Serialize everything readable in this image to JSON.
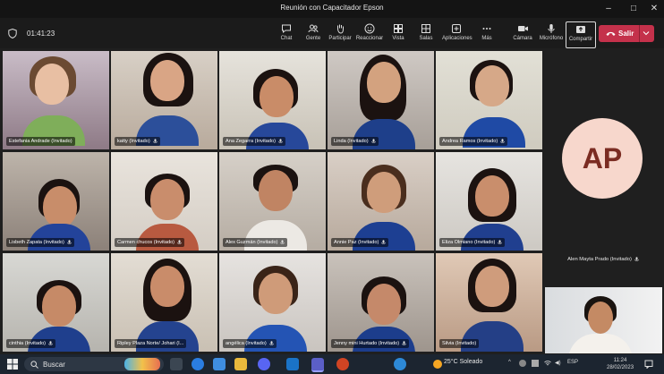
{
  "window": {
    "title": "Reunión con Capacitador Epson",
    "minimize": "–",
    "maximize": "□",
    "close": "✕"
  },
  "toolbar": {
    "timer": "01:41:23",
    "buttons": [
      {
        "label": "Chat",
        "icon": "chat-icon"
      },
      {
        "label": "Gente",
        "icon": "people-icon"
      },
      {
        "label": "Participar",
        "icon": "raise-hand-icon"
      },
      {
        "label": "Reaccionar",
        "icon": "emoji-icon"
      },
      {
        "label": "Vista",
        "icon": "grid-view-icon"
      },
      {
        "label": "Salas",
        "icon": "rooms-icon"
      },
      {
        "label": "Aplicaciones",
        "icon": "apps-icon"
      },
      {
        "label": "Más",
        "icon": "more-icon"
      },
      {
        "label": "Cámara",
        "icon": "camera-icon"
      },
      {
        "label": "Micrófono",
        "icon": "microphone-icon"
      },
      {
        "label": "Compartir",
        "icon": "share-icon"
      }
    ],
    "leave_label": "Salir"
  },
  "participants": [
    {
      "name": "Estefania Andrade (Invitado)"
    },
    {
      "name": "katty (Invitado)"
    },
    {
      "name": "Ana Zegarra (Invitado)"
    },
    {
      "name": "Linda (Invitado)"
    },
    {
      "name": "Andrea Ramos (Invitado)"
    },
    {
      "name": "Lisbeth Zapata (Invitado)"
    },
    {
      "name": "Carmen chucos (Invitado)"
    },
    {
      "name": "Alex Guzmán (Invitado)"
    },
    {
      "name": "Annie Paz (Invitado)"
    },
    {
      "name": "Eliza Olmiano (Invitado)"
    },
    {
      "name": "cinthia (Invitado)"
    },
    {
      "name": "Ripley Plaza Norte/ Johari (I..."
    },
    {
      "name": "angélica (Invitado)"
    },
    {
      "name": "Jenny mini Hurtado (Invitado)"
    },
    {
      "name": "Silvia (Invitado)"
    }
  ],
  "side_participant": {
    "initials": "AP",
    "name": "Alen Mayta Prado (Invitado)"
  },
  "taskbar": {
    "search_label": "Buscar",
    "weather": "25°C  Soleado",
    "language": "ESP",
    "time": "11:24",
    "date": "28/02/2023"
  },
  "colors": {
    "leave": "#c4314b",
    "selected_outline": "#8b8ef0",
    "avatar_bg": "#f7d7cc",
    "avatar_text": "#7b2c22"
  }
}
